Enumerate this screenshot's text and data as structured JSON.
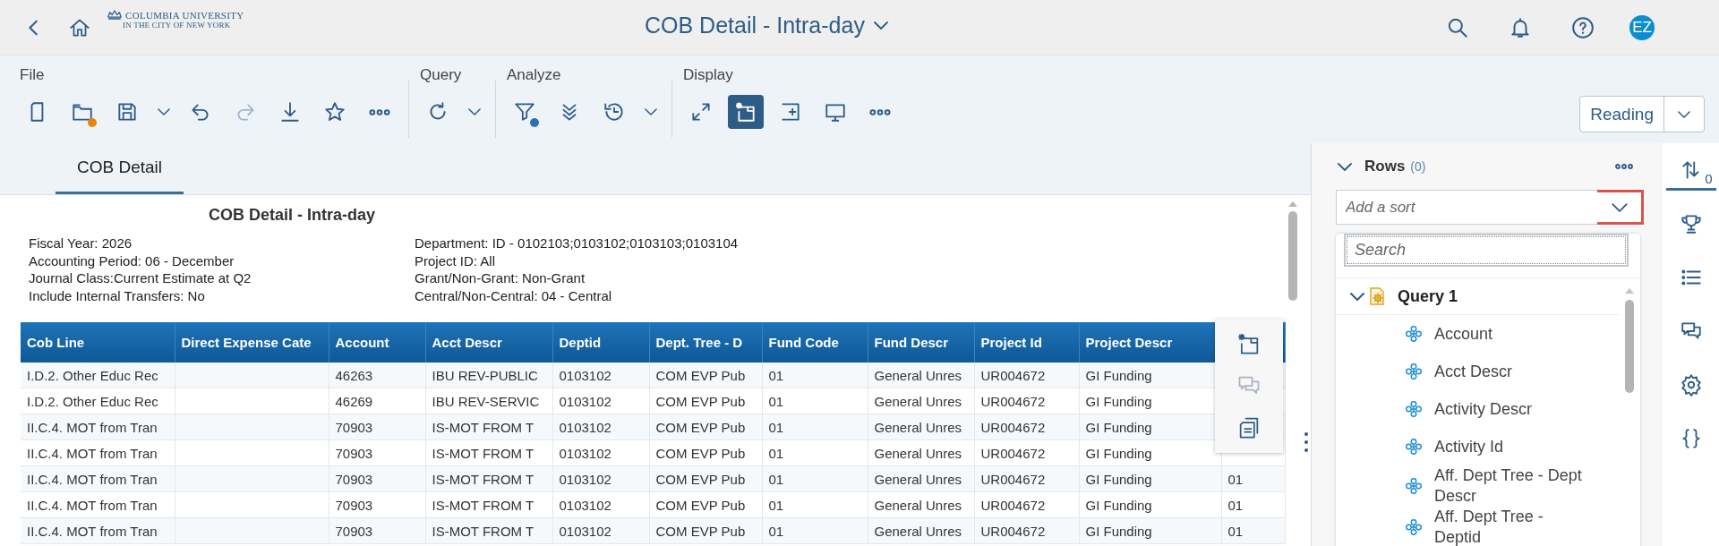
{
  "shell": {
    "logo_name": "COLUMBIA UNIVERSITY",
    "logo_sub": "IN THE CITY OF NEW YORK",
    "title": "COB Detail - Intra-day",
    "avatar": "EZ"
  },
  "toolbar": {
    "groups": [
      {
        "label": "File",
        "tools": [
          {
            "kind": "button",
            "disabled": false
          },
          {
            "kind": "button",
            "disabled": false,
            "color": "#e8850d"
          },
          {
            "kind": "button",
            "disabled": false
          },
          {
            "kind": "menu",
            "disabled": false
          },
          {
            "kind": "button",
            "disabled": false
          },
          {
            "kind": "button",
            "disabled": true
          },
          {
            "kind": "button",
            "disabled": false
          },
          {
            "kind": "button",
            "disabled": false
          },
          {
            "kind": "button",
            "disabled": false
          }
        ]
      },
      {
        "label": "Query",
        "tools": [
          {
            "kind": "button",
            "disabled": false
          },
          {
            "kind": "menu",
            "disabled": false
          }
        ]
      },
      {
        "label": "Analyze",
        "tools": [
          {
            "kind": "button",
            "disabled": false,
            "color": "#2f6fb3"
          },
          {
            "kind": "button",
            "disabled": false
          },
          {
            "kind": "button",
            "disabled": false
          },
          {
            "kind": "menu",
            "disabled": false
          }
        ]
      },
      {
        "label": "Display",
        "tools": [
          {
            "kind": "button",
            "selected": false
          },
          {
            "kind": "button",
            "selected": true
          },
          {
            "kind": "button",
            "selected": false
          },
          {
            "kind": "button",
            "selected": false
          },
          {
            "kind": "button",
            "selected": false
          }
        ]
      }
    ],
    "mode": {
      "label": "Reading"
    }
  },
  "tabs": [
    {
      "label": "COB Detail",
      "selected": true
    }
  ],
  "report": {
    "title": "COB Detail - Intra-day",
    "filters_left": [
      "Fiscal Year: 2026",
      "Accounting Period: 06 - December",
      "Journal Class:Current Estimate at Q2",
      "Include Internal Transfers: No"
    ],
    "filters_right": [
      "Department: ID - 0102103;0103102;0103103;0103104",
      "Project ID: All",
      "Grant/Non-Grant: Non-Grant",
      "Central/Non-Central: 04 - Central"
    ],
    "table": {
      "columns": [
        "Cob Line",
        "Direct Expense Cate",
        "Account",
        "Acct Descr",
        "Deptid",
        "Dept. Tree - D",
        "Fund Code",
        "Fund Descr",
        "Project Id",
        "Project Descr"
      ],
      "rows": [
        {
          "cells": [
            "I.D.2. Other Educ Rec",
            "",
            "46263",
            "IBU REV-PUBLIC",
            "0103102",
            "COM EVP Pub",
            "01",
            "General Unres",
            "UR004672",
            "GI Funding"
          ]
        },
        {
          "cells": [
            "I.D.2. Other Educ Rec",
            "",
            "46269",
            "IBU REV-SERVIC",
            "0103102",
            "COM EVP Pub",
            "01",
            "General Unres",
            "UR004672",
            "GI Funding"
          ]
        },
        {
          "cells": [
            "II.C.4. MOT from Tran",
            "",
            "70903",
            "IS-MOT FROM T",
            "0103102",
            "COM EVP Pub",
            "01",
            "General Unres",
            "UR004672",
            "GI Funding"
          ]
        },
        {
          "cells": [
            "II.C.4. MOT from Tran",
            "",
            "70903",
            "IS-MOT FROM T",
            "0103102",
            "COM EVP Pub",
            "01",
            "General Unres",
            "UR004672",
            "GI Funding"
          ]
        },
        {
          "cells": [
            "II.C.4. MOT from Tran",
            "",
            "70903",
            "IS-MOT FROM T",
            "0103102",
            "COM EVP Pub",
            "01",
            "General Unres",
            "UR004672",
            "GI Funding"
          ],
          "column_11": "01"
        },
        {
          "cells": [
            "II.C.4. MOT from Tran",
            "",
            "70903",
            "IS-MOT FROM T",
            "0103102",
            "COM EVP Pub",
            "01",
            "General Unres",
            "UR004672",
            "GI Funding"
          ],
          "column_11": "01"
        },
        {
          "cells": [
            "II.C.4. MOT from Tran",
            "",
            "70903",
            "IS-MOT FROM T",
            "0103102",
            "COM EVP Pub",
            "01",
            "General Unres",
            "UR004672",
            "GI Funding"
          ],
          "column_11": "01"
        }
      ]
    },
    "cell_menu": [
      {
        "disabled": false
      },
      {
        "disabled": true
      },
      {
        "disabled": false
      }
    ]
  },
  "builder": {
    "section": {
      "title": "Rows",
      "count": "(0)",
      "expanded": true
    },
    "sort_field": {
      "placeholder": "Add a sort",
      "toggle_highlighted": true
    },
    "dropdown": {
      "search": {
        "placeholder": "Search"
      },
      "tree": [
        {
          "label": "Query 1",
          "expanded": true,
          "children": [
            {
              "label": "Account"
            },
            {
              "label": "Acct Descr"
            },
            {
              "label": "Activity Descr"
            },
            {
              "label": "Activity Id"
            },
            {
              "label": "Aff. Dept Tree - Dept Descr"
            },
            {
              "label": "Aff. Dept Tree - Deptid"
            }
          ]
        }
      ]
    }
  },
  "rail": [
    {
      "selected": true,
      "count": "0"
    },
    {
      "selected": false
    },
    {
      "selected": false
    },
    {
      "selected": false
    },
    {
      "selected": false
    },
    {
      "selected": false
    }
  ]
}
